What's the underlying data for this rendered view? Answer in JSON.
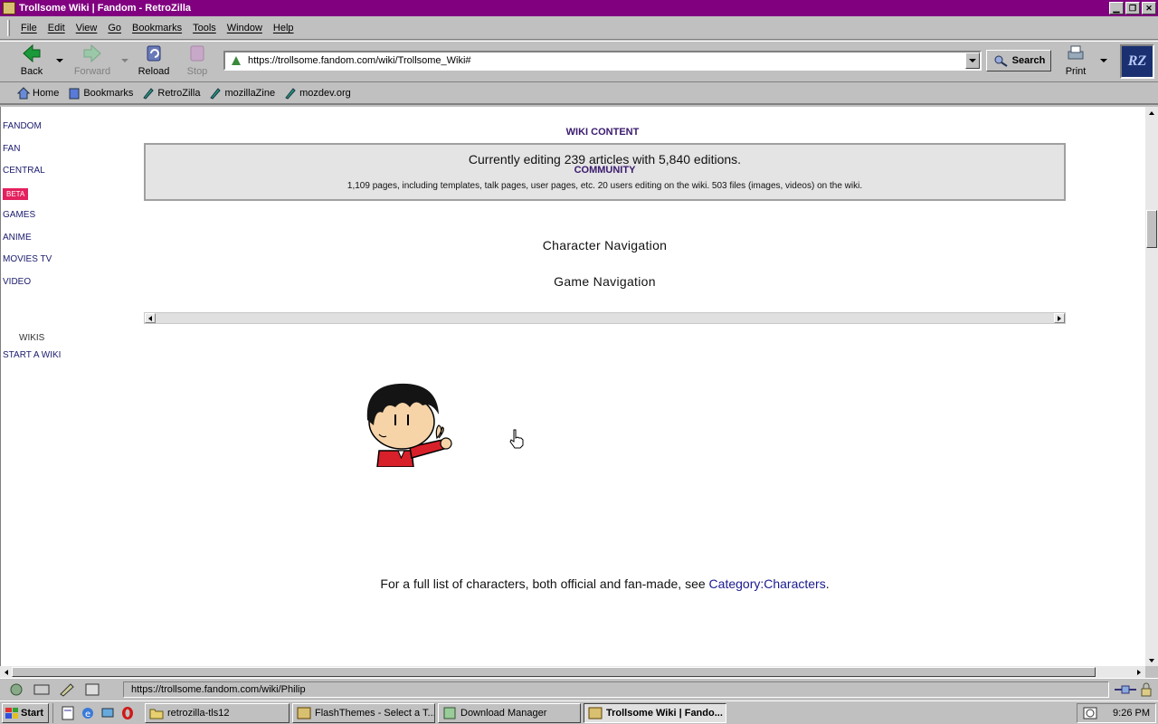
{
  "window": {
    "title": "Trollsome Wiki | Fandom - RetroZilla",
    "controls": [
      "minimize",
      "maximize",
      "close"
    ]
  },
  "menu": [
    "File",
    "Edit",
    "View",
    "Go",
    "Bookmarks",
    "Tools",
    "Window",
    "Help"
  ],
  "toolbar": {
    "back_label": "Back",
    "forward_label": "Forward",
    "reload_label": "Reload",
    "stop_label": "Stop",
    "url": "https://trollsome.fandom.com/wiki/Trollsome_Wiki#",
    "search_label": "Search",
    "print_label": "Print",
    "logo_text": "RZ"
  },
  "bookmarks": [
    "Home",
    "Bookmarks",
    "RetroZilla",
    "mozillaZine",
    "mozdev.org"
  ],
  "left_nav": {
    "items": [
      "FANDOM",
      "FAN",
      "CENTRAL",
      "BETA",
      "GAMES",
      "ANIME",
      "MOVIES TV",
      "VIDEO"
    ],
    "wikis_label": "WIKIS",
    "start_wiki": "START A WIKI"
  },
  "content": {
    "wiki_content_heading": "WIKI CONTENT",
    "stats_main": "Currently editing 239 articles with 5,840 editions.",
    "community_heading": "COMMUNITY",
    "stats_sub": "1,109 pages, including templates, talk pages, user pages, etc. 20 users editing on the wiki. 503 files (images, videos) on the wiki.",
    "character_nav": "Character Navigation",
    "game_nav": "Game Navigation",
    "footnote_prefix": "For a full list of characters, both official and fan-made, see ",
    "footnote_link": "Category:Characters",
    "footnote_suffix": "."
  },
  "status": {
    "text": "https://trollsome.fandom.com/wiki/Philip"
  },
  "taskbar": {
    "start_label": "Start",
    "tasks": [
      {
        "label": "retrozilla-tls12",
        "active": false
      },
      {
        "label": "FlashThemes - Select a T...",
        "active": false
      },
      {
        "label": "Download Manager",
        "active": false
      },
      {
        "label": "Trollsome Wiki | Fando...",
        "active": true
      }
    ],
    "clock": "9:26 PM"
  },
  "colors": {
    "titlebar": "#800080",
    "link": "#1a1a6e",
    "beta_badge": "#e4215e",
    "heading": "#3a1a6e"
  }
}
